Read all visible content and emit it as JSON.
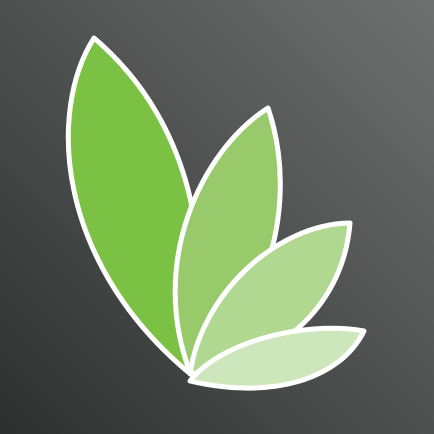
{
  "app_icon": {
    "icon_name": "leaves-icon",
    "colors": {
      "background_light": "#6f7171",
      "background_dark": "#2e2f2f",
      "leaf_1": "#7bc143",
      "leaf_2": "#98ca6b",
      "leaf_3": "#b0d890",
      "leaf_4": "#cde6bc",
      "outline": "#ffffff"
    }
  }
}
